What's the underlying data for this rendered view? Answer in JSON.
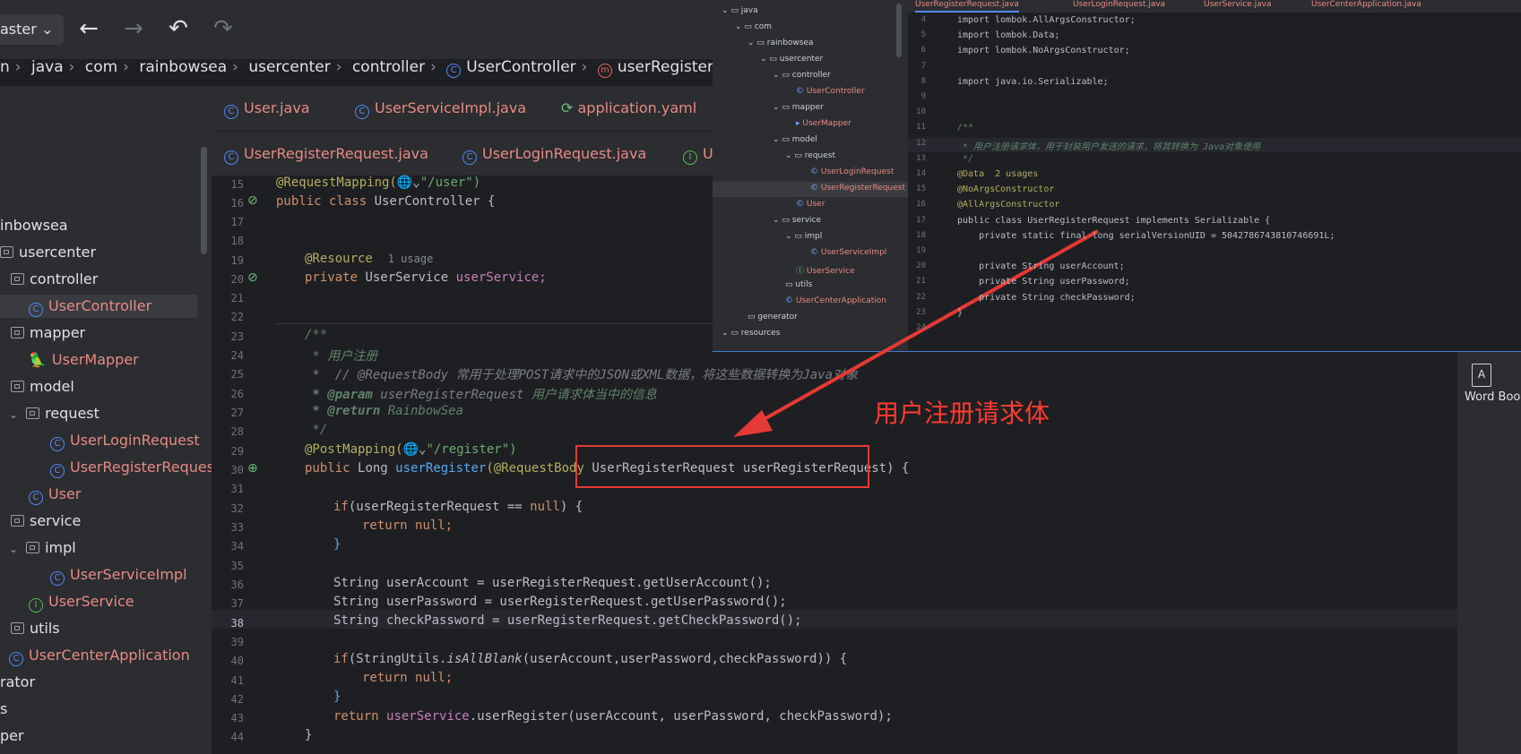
{
  "toolbar": {
    "branch": "aster",
    "branch_chevron": "chevron-down-icon",
    "back": "←",
    "forward": "→",
    "undo": "↶",
    "redo": "↷"
  },
  "breadcrumb": [
    "n",
    "java",
    "com",
    "rainbowsea",
    "usercenter",
    "controller",
    "UserController",
    "userRegister"
  ],
  "tree": {
    "items": [
      {
        "label": "inbowsea"
      },
      {
        "label": "usercenter"
      },
      {
        "label": "controller"
      },
      {
        "label": "UserController"
      },
      {
        "label": "mapper"
      },
      {
        "label": "UserMapper"
      },
      {
        "label": "model"
      },
      {
        "label": "request"
      },
      {
        "label": "UserLoginRequest"
      },
      {
        "label": "UserRegisterRequest"
      },
      {
        "label": "User"
      },
      {
        "label": "service"
      },
      {
        "label": "impl"
      },
      {
        "label": "UserServiceImpl"
      },
      {
        "label": "UserService"
      },
      {
        "label": "utils"
      },
      {
        "label": "UserCenterApplication"
      },
      {
        "label": "rator"
      },
      {
        "label": "s"
      },
      {
        "label": "per"
      }
    ]
  },
  "tabs_row1": [
    "User.java",
    "UserServiceImpl.java",
    "application.yaml"
  ],
  "tabs_row2": [
    "UserRegisterRequest.java",
    "UserLoginRequest.java",
    "U"
  ],
  "code": {
    "line_numbers": [
      "15",
      "16",
      "17",
      "18",
      "19",
      "20",
      "21",
      "22",
      "23",
      "24",
      "25",
      "26",
      "27",
      "28",
      "29",
      "30",
      "31",
      "32",
      "33",
      "34",
      "35",
      "36",
      "37",
      "38",
      "39",
      "40",
      "41",
      "42",
      "43",
      "44"
    ],
    "l15_a": "@RequestMapping(",
    "l15_b": "\"/user\")",
    "l16_a": "public class ",
    "l16_b": "UserController {",
    "l19_a": "@Resource",
    "l19_hint": "1 usage",
    "l20_a": "private ",
    "l20_b": "UserService ",
    "l20_c": "userService;",
    "l23": "/**",
    "l24": " * 用户注册",
    "l25": " *  // @RequestBody 常用于处理POST请求中的JSON或XML数据，将这些数据转换为Java对象",
    "l26_a": " * @param ",
    "l26_b": "userRegisterRequest ",
    "l26_c": "用户请求体当中的信息",
    "l27_a": " * @return ",
    "l27_b": "RainbowSea",
    "l28": " */",
    "l29_a": "@PostMapping(",
    "l29_b": "\"/register\")",
    "l30_a": "public ",
    "l30_b": "Long ",
    "l30_c": "userRegister",
    "l30_d": "(@RequestBody ",
    "l30_e": "UserRegisterRequest userRegisterRequest) {",
    "l32_a": "if",
    "l32_b": "(userRegisterRequest == ",
    "l32_c": "null",
    "l32_d": ") {",
    "l33_a": "return ",
    "l33_b": "null;",
    "l34": "}",
    "l36": "String userAccount = userRegisterRequest.getUserAccount();",
    "l37": "String userPassword = userRegisterRequest.getUserPassword();",
    "l38": "String checkPassword = userRegisterRequest.getCheckPassword();",
    "l40_a": "if",
    "l40_b": "(StringUtils.",
    "l40_c": "isAllBlank",
    "l40_d": "(userAccount,userPassword,checkPassword)) {",
    "l41_a": "return ",
    "l41_b": "null;",
    "l42": "}",
    "l43_a": "return ",
    "l43_b": "userService",
    "l43_c": ".userRegister(userAccount, userPassword, checkPassword);",
    "l44": "}"
  },
  "overlay": {
    "tabs": [
      "UserRegisterRequest.java",
      "UserLoginRequest.java",
      "UserService.java",
      "UserCenterApplication.java"
    ],
    "tree": [
      "java",
      "com",
      "rainbowsea",
      "usercenter",
      "controller",
      "UserController",
      "mapper",
      "UserMapper",
      "model",
      "request",
      "UserLoginRequest",
      "UserRegisterRequest",
      "User",
      "service",
      "impl",
      "UserServiceImpl",
      "UserService",
      "utils",
      "UserCenterApplication",
      "generator",
      "resources"
    ],
    "line_numbers": [
      "4",
      "5",
      "6",
      "7",
      "8",
      "9",
      "10",
      "11",
      "12",
      "13",
      "14",
      "15",
      "16",
      "17",
      "18",
      "19",
      "20",
      "21",
      "22",
      "23",
      "24"
    ],
    "lines": [
      "import lombok.AllArgsConstructor;",
      "import lombok.Data;",
      "import lombok.NoArgsConstructor;",
      "",
      "import java.io.Serializable;",
      "",
      "",
      "/**",
      " * 用户注册请求体，用于封装用户发送的请求，将其转换为 Java对象使用",
      " */",
      "@Data  2 usages",
      "@NoArgsConstructor",
      "@AllArgsConstructor",
      "public class UserRegisterRequest implements Serializable {",
      "    private static final long serialVersionUID = 5042786743810746691L;",
      "",
      "    private String userAccount;",
      "    private String userPassword;",
      "    private String checkPassword;",
      "}",
      ""
    ]
  },
  "annotation": "用户注册请求体",
  "right_panel": {
    "word_book": "Word Boo"
  },
  "colors": {
    "annotation_red": "#e53935",
    "accent_blue": "#548af7"
  }
}
